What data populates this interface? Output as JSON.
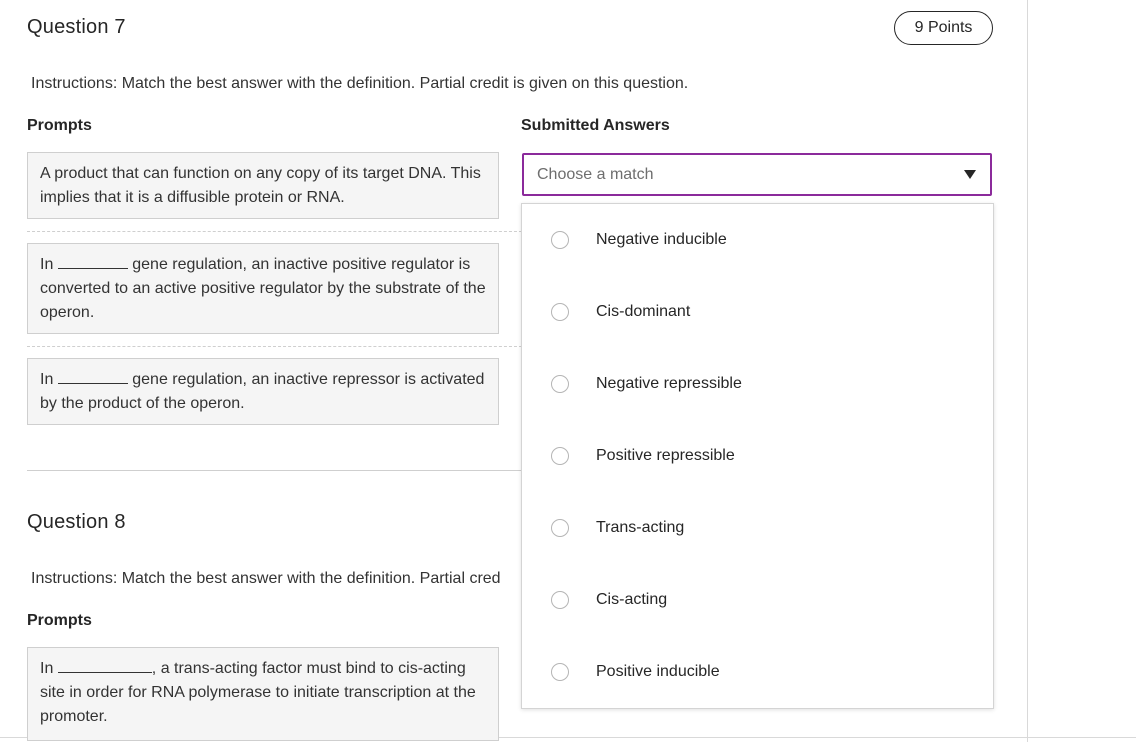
{
  "q7": {
    "title": "Question 7",
    "points": "9 Points",
    "instructions": "Instructions: Match the best answer with the definition. Partial credit is given on this question.",
    "prompts_header": "Prompts",
    "answers_header": "Submitted Answers",
    "prompts": [
      {
        "text": "A product that can function on any copy of its target DNA. This implies that it is a diffusible protein or RNA."
      },
      {
        "pre": "In ",
        "post": " gene regulation, an inactive positive regulator is converted to an active positive regulator by the substrate of the operon."
      },
      {
        "pre": "In ",
        "post": " gene regulation, an inactive repressor is activated by the product of the operon."
      }
    ],
    "select_placeholder": "Choose a match",
    "options": [
      "Negative inducible",
      "Cis-dominant",
      "Negative repressible",
      "Positive repressible",
      "Trans-acting",
      "Cis-acting",
      "Positive inducible"
    ]
  },
  "q8": {
    "title": "Question 8",
    "instructions": "Instructions: Match the best answer with the definition. Partial cred",
    "prompts_header": "Prompts",
    "prompts": [
      {
        "pre": "In ",
        "post": ", a trans-acting factor must bind to cis-acting site in order for RNA polymerase to initiate transcription at the promoter."
      }
    ]
  },
  "colors": {
    "accent": "#8b2a9b",
    "box_bg": "#f5f5f5",
    "border": "#cfcfcf"
  }
}
